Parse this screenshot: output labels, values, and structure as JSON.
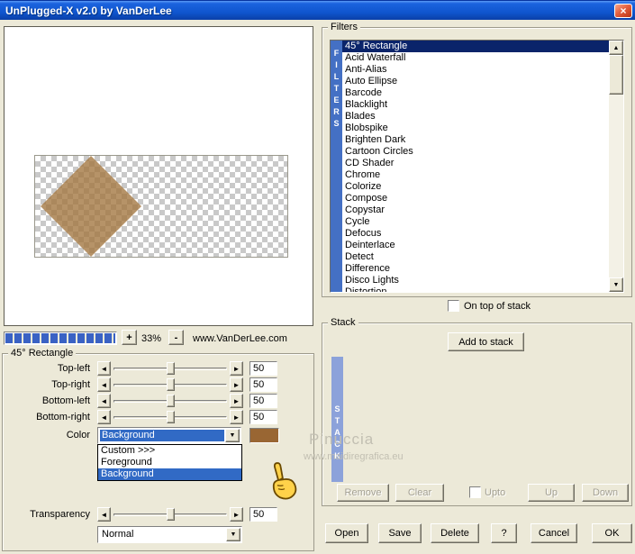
{
  "window": {
    "title": "UnPlugged-X v2.0 by VanDerLee"
  },
  "icons": {
    "close": "×",
    "left_arrow": "◄",
    "right_arrow": "►",
    "down_arrow": "▼",
    "scroll_up": "▲",
    "scroll_down": "▼"
  },
  "zoom": {
    "plus": "+",
    "level": "33%",
    "minus": "-",
    "website": "www.VanDerLee.com"
  },
  "filters": {
    "group_label": "Filters",
    "strip": "FILTERS",
    "selected_index": 0,
    "items": [
      "45° Rectangle",
      "Acid Waterfall",
      "Anti-Alias",
      "Auto Ellipse",
      "Barcode",
      "Blacklight",
      "Blades",
      "Blobspike",
      "Brighten Dark",
      "Cartoon Circles",
      "CD Shader",
      "Chrome",
      "Colorize",
      "Compose",
      "Copystar",
      "Cycle",
      "Defocus",
      "Deinterlace",
      "Detect",
      "Difference",
      "Disco Lights",
      "Distortion"
    ],
    "on_top_label": "On top of stack",
    "on_top_checked": false
  },
  "params": {
    "group_label": "45° Rectangle",
    "sliders": [
      {
        "label": "Top-left",
        "value": "50"
      },
      {
        "label": "Top-right",
        "value": "50"
      },
      {
        "label": "Bottom-left",
        "value": "50"
      },
      {
        "label": "Bottom-right",
        "value": "50"
      }
    ],
    "color_label": "Color",
    "color_value": "Background",
    "color_options": [
      "Custom >>>",
      "Foreground",
      "Background"
    ],
    "color_selected_option": 2,
    "transparency_label": "Transparency",
    "transparency_value": "50",
    "blend_mode": "Normal"
  },
  "stack": {
    "group_label": "Stack",
    "strip": "STACK",
    "add_button": "Add to stack",
    "remove_button": "Remove",
    "clear_button": "Clear",
    "upto_label": "Upto",
    "upto_checked": false,
    "up_button": "Up",
    "down_button": "Down",
    "watermark": "Pinuccia",
    "watermark_url": "www.maidiregrafica.eu"
  },
  "footer": {
    "open": "Open",
    "save": "Save",
    "delete": "Delete",
    "help": "?",
    "cancel": "Cancel",
    "ok": "OK"
  },
  "colors": {
    "swatch": "#996633",
    "diamond": "#A47842",
    "highlight": "#316AC5",
    "list_selected": "#0A246A",
    "filters_strip": "#4470C4",
    "stack_strip": "#8CA2DA",
    "progress_segment": "#3A62C4"
  }
}
